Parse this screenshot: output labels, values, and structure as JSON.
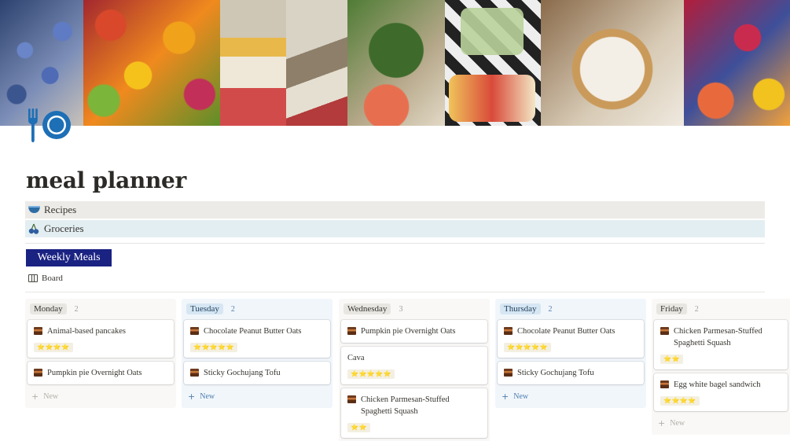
{
  "page": {
    "title": "meal planner",
    "icon": "fork-plate-icon"
  },
  "links": [
    {
      "label": "Recipes",
      "icon": "bowl-icon"
    },
    {
      "label": "Groceries",
      "icon": "cherries-icon"
    }
  ],
  "database": {
    "title": "Weekly Meals",
    "view_label": "Board",
    "view_icon": "board-icon",
    "new_label": "New"
  },
  "colors": {
    "accent": "#1a2282",
    "blue_column": "#f1f6fb",
    "gray_column": "#f9f8f6",
    "star": "#e8b520"
  },
  "columns": [
    {
      "name": "Monday",
      "count": "2",
      "style": "gray",
      "cards": [
        {
          "title": "Animal-based pancakes",
          "emoji": "bento-icon",
          "rating": "⭐⭐⭐⭐"
        },
        {
          "title": "Pumpkin pie Overnight Oats",
          "emoji": "bento-icon",
          "rating": ""
        }
      ]
    },
    {
      "name": "Tuesday",
      "count": "2",
      "style": "blue",
      "cards": [
        {
          "title": "Chocolate Peanut Butter Oats",
          "emoji": "bento-icon",
          "rating": "⭐⭐⭐⭐⭐"
        },
        {
          "title": "Sticky Gochujang Tofu",
          "emoji": "bento-icon",
          "rating": ""
        }
      ]
    },
    {
      "name": "Wednesday",
      "count": "3",
      "style": "gray",
      "cards": [
        {
          "title": "Pumpkin pie Overnight Oats",
          "emoji": "bento-icon",
          "rating": ""
        },
        {
          "title": "Cava",
          "emoji": "",
          "rating": "⭐⭐⭐⭐⭐"
        },
        {
          "title": "Chicken Parmesan-Stuffed Spaghetti Squash",
          "emoji": "bento-icon",
          "rating": "⭐⭐"
        }
      ]
    },
    {
      "name": "Thursday",
      "count": "2",
      "style": "blue",
      "cards": [
        {
          "title": "Chocolate Peanut Butter Oats",
          "emoji": "bento-icon",
          "rating": "⭐⭐⭐⭐⭐"
        },
        {
          "title": "Sticky Gochujang Tofu",
          "emoji": "bento-icon",
          "rating": ""
        }
      ]
    },
    {
      "name": "Friday",
      "count": "2",
      "style": "gray",
      "cards": [
        {
          "title": "Chicken Parmesan-Stuffed Spaghetti Squash",
          "emoji": "bento-icon",
          "rating": "⭐⭐"
        },
        {
          "title": "Egg white bagel sandwich",
          "emoji": "bento-icon",
          "rating": "⭐⭐⭐⭐"
        }
      ]
    }
  ]
}
